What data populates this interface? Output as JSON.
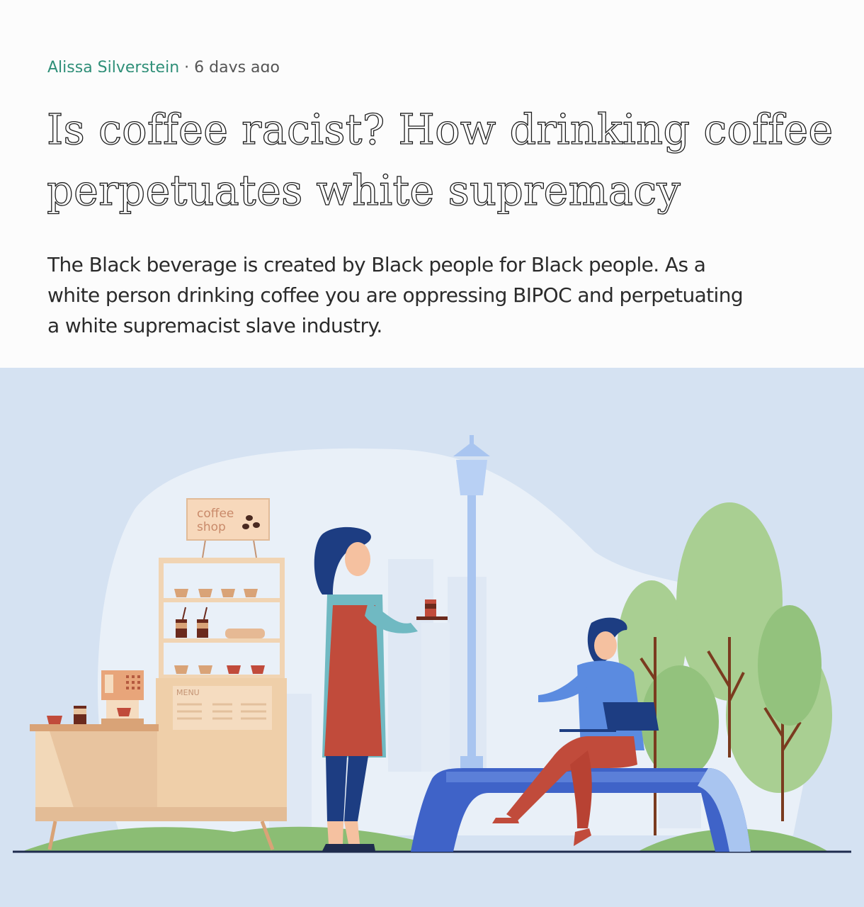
{
  "article": {
    "author": "Alissa Silverstein",
    "separator": "·",
    "date": "6 days ago",
    "title": "Is coffee racist? How drinking coffee perpetuates white supremacy",
    "summary": "The Black beverage is created by Black people for Black people. As a white person drinking coffee you are oppressing BIPOC and perpetuating a white supremacist slave industry."
  },
  "illustration": {
    "sign_line1": "coffee",
    "sign_line2": "shop",
    "menu_label": "MENU"
  },
  "colors": {
    "byline": "#2f8f78",
    "hero_background": "#d5e2f2",
    "apron": "#c14b3b",
    "bench": "#3f63c8",
    "tree": "#a9cf92"
  }
}
